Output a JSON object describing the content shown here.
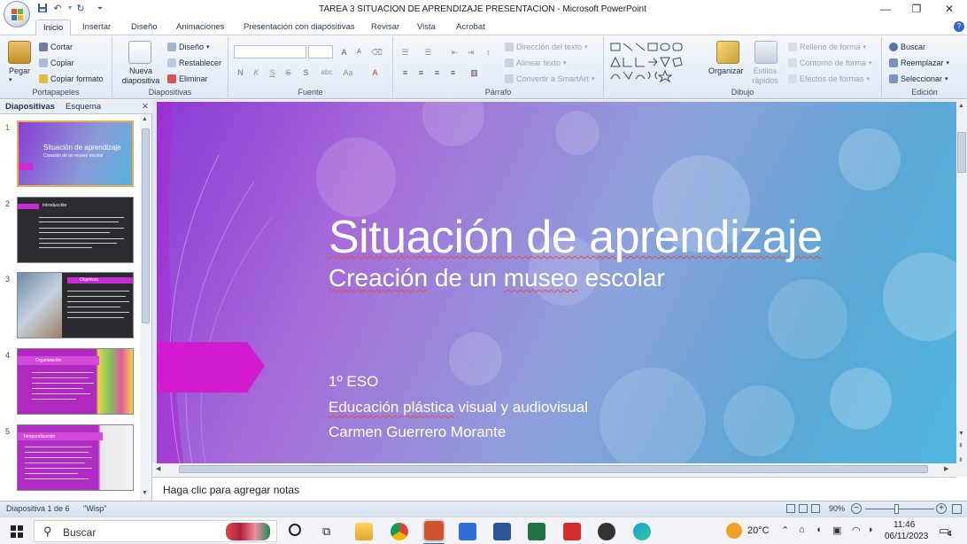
{
  "window": {
    "title": "TAREA 3 SITUACION DE APRENDIZAJE PRESENTACION - Microsoft PowerPoint",
    "minimize": "—",
    "restore": "❐",
    "close": "✕"
  },
  "quick_access": {
    "save_icon": "save-icon",
    "undo_icon": "undo-icon",
    "redo_icon": "redo-icon",
    "customize_icon": "dropdown-icon"
  },
  "tabs": [
    "Inicio",
    "Insertar",
    "Diseño",
    "Animaciones",
    "Presentación con diapositivas",
    "Revisar",
    "Vista",
    "Acrobat"
  ],
  "active_tab": "Inicio",
  "help_icon": "help-icon",
  "ribbon": {
    "portapapeles": {
      "label": "Portapapeles",
      "paste": "Pegar",
      "cut": "Cortar",
      "copy": "Copiar",
      "format_painter": "Copiar formato"
    },
    "diapositivas": {
      "label": "Diapositivas",
      "new_slide": "Nueva diapositiva",
      "layout": "Diseño",
      "reset": "Restablecer",
      "delete": "Eliminar"
    },
    "fuente": {
      "label": "Fuente",
      "bold": "N",
      "italic": "K",
      "strike": "S",
      "shadow": "S",
      "spacing": "abc",
      "case": "Aa",
      "grow": "A",
      "shrink": "A"
    },
    "parrafo": {
      "label": "Párrafo",
      "text_direction": "Dirección del texto",
      "align_text": "Alinear texto",
      "smartart": "Convertir a SmartArt"
    },
    "dibujo": {
      "label": "Dibujo",
      "arrange": "Organizar",
      "quick_styles": "Estilos rápidos",
      "fill": "Relleno de forma",
      "outline": "Contorno de forma",
      "effects": "Efectos de formas"
    },
    "edicion": {
      "label": "Edición",
      "find": "Buscar",
      "replace": "Reemplazar",
      "select": "Seleccionar"
    }
  },
  "left_pane": {
    "tab_slides": "Diapositivas",
    "tab_outline": "Esquema",
    "thumbnails": [
      {
        "num": "1",
        "title": "Situación de aprendizaje",
        "subtitle": "Creación de un museo escolar"
      },
      {
        "num": "2",
        "title": "Introducción"
      },
      {
        "num": "3",
        "title": "Objetivos"
      },
      {
        "num": "4",
        "title": "Organización"
      },
      {
        "num": "5",
        "title": "Temporalización"
      }
    ]
  },
  "slide": {
    "title": "Situación de aprendizaje",
    "subtitle_parts": [
      "Creación",
      " de un ",
      "museo",
      " escolar"
    ],
    "line1": "1º ESO",
    "line2_parts": [
      "Educación plástica",
      " visual y audiovisual"
    ],
    "line3": "Carmen Guerrero Morante"
  },
  "notes": {
    "placeholder": "Haga clic para agregar notas"
  },
  "status": {
    "slide_info": "Diapositiva 1 de 6",
    "theme": "\"Wisp\"",
    "zoom": "90%",
    "zoom_level": 0.45
  },
  "taskbar": {
    "search": "Buscar",
    "weather": "20°C",
    "time": "11:46",
    "date": "06/11/2023",
    "notifications": "4"
  },
  "colors": {
    "accent": "#c23bd6",
    "ribbon_bg": "#dfe8f4",
    "word_blue": "#2b579a",
    "excel_green": "#217346"
  }
}
